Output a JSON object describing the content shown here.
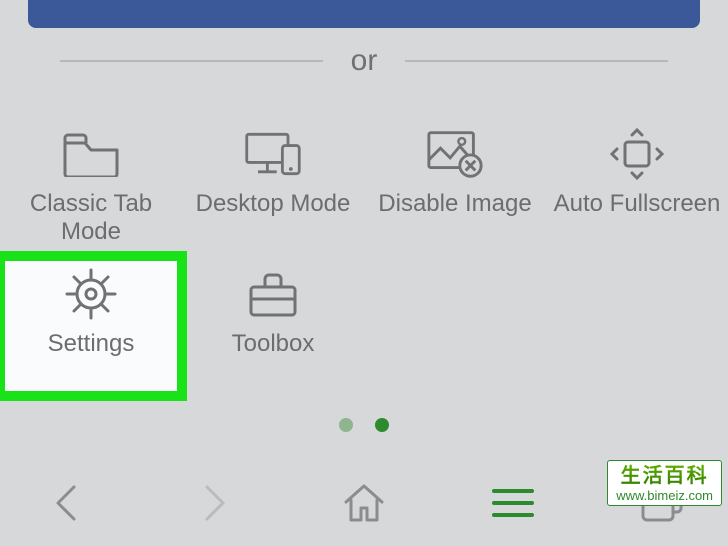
{
  "divider": {
    "text": "or"
  },
  "grid": {
    "items": [
      {
        "id": "classic-tab-mode",
        "label": "Classic Tab Mode",
        "icon": "folder-icon"
      },
      {
        "id": "desktop-mode",
        "label": "Desktop Mode",
        "icon": "desktop-icon"
      },
      {
        "id": "disable-image",
        "label": "Disable Image",
        "icon": "image-off-icon"
      },
      {
        "id": "auto-fullscreen",
        "label": "Auto Fullscreen",
        "icon": "fullscreen-icon"
      },
      {
        "id": "settings",
        "label": "Settings",
        "icon": "gear-icon",
        "highlighted": true
      },
      {
        "id": "toolbox",
        "label": "Toolbox",
        "icon": "toolbox-icon"
      }
    ]
  },
  "pager": {
    "count": 2,
    "active_index": 1
  },
  "toolbar": {
    "back": "Back",
    "forward": "Forward",
    "home": "Home",
    "menu": "Menu",
    "tabs": "Tabs"
  },
  "watermark": {
    "title": "生活百科",
    "url": "www.bimeiz.com"
  },
  "colors": {
    "background": "#d7d8d9",
    "highlight_border": "#18e218",
    "highlight_fill": "#fafbfc",
    "accent_green": "#2d8a2d",
    "icon_gray": "#707274",
    "top_bar": "#3b5998"
  }
}
